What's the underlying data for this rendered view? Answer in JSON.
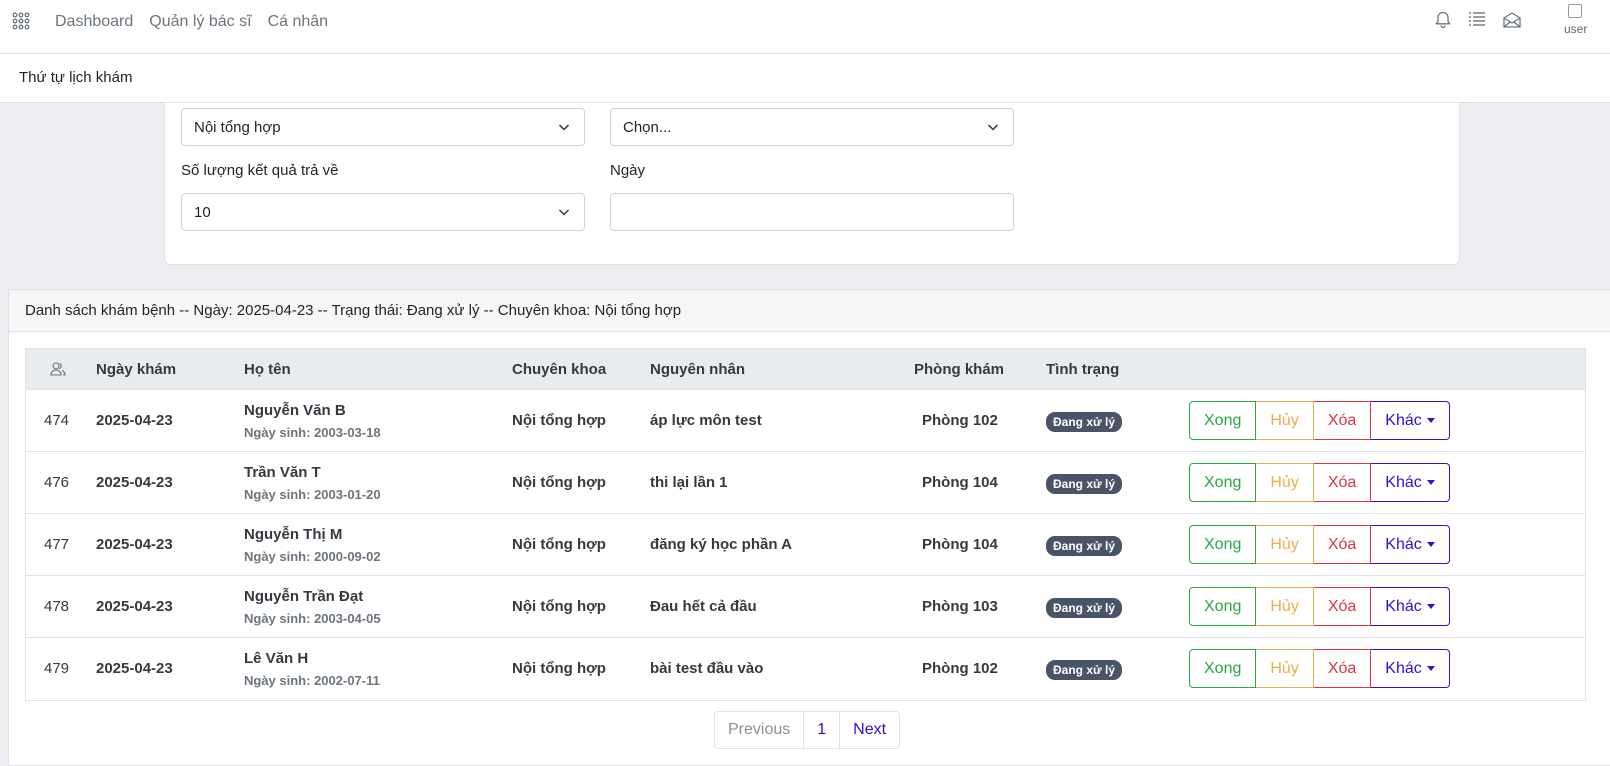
{
  "nav": {
    "links": [
      "Dashboard",
      "Quản lý bác sĩ",
      "Cá nhân"
    ],
    "avatar_alt": "user"
  },
  "subheader": {
    "title": "Thứ tự lịch khám"
  },
  "filters": {
    "specialty_value": "Nội tổng hợp",
    "second_select_value": "Chọn...",
    "limit_label": "Số lượng kết quả trả về",
    "limit_value": "10",
    "date_label": "Ngày",
    "date_value": ""
  },
  "list": {
    "header": "Danh sách khám bệnh -- Ngày: 2025-04-23 -- Trạng thái: Đang xử lý -- Chuyên khoa: Nội tổng hợp",
    "columns": {
      "date": "Ngày khám",
      "name": "Họ tên",
      "specialty": "Chuyên khoa",
      "reason": "Nguyên nhân",
      "room": "Phòng khám",
      "status": "Tình trạng"
    },
    "rows": [
      {
        "id": "474",
        "date": "2025-04-23",
        "name": "Nguyễn Văn B",
        "dob": "Ngày sinh: 2003-03-18",
        "specialty": "Nội tổng hợp",
        "reason": "áp lực môn test",
        "room": "Phòng 102",
        "status": "Đang xử lý"
      },
      {
        "id": "476",
        "date": "2025-04-23",
        "name": "Trần Văn T",
        "dob": "Ngày sinh: 2003-01-20",
        "specialty": "Nội tổng hợp",
        "reason": "thi lại lần 1",
        "room": "Phòng 104",
        "status": "Đang xử lý"
      },
      {
        "id": "477",
        "date": "2025-04-23",
        "name": "Nguyễn Thị M",
        "dob": "Ngày sinh: 2000-09-02",
        "specialty": "Nội tổng hợp",
        "reason": "đăng ký học phần A",
        "room": "Phòng 104",
        "status": "Đang xử lý"
      },
      {
        "id": "478",
        "date": "2025-04-23",
        "name": "Nguyễn Trần Đạt",
        "dob": "Ngày sinh: 2003-04-05",
        "specialty": "Nội tổng hợp",
        "reason": "Đau hết cả đầu",
        "room": "Phòng 103",
        "status": "Đang xử lý"
      },
      {
        "id": "479",
        "date": "2025-04-23",
        "name": "Lê Văn H",
        "dob": "Ngày sinh: 2002-07-11",
        "specialty": "Nội tổng hợp",
        "reason": "bài test đầu vào",
        "room": "Phòng 102",
        "status": "Đang xử lý"
      }
    ],
    "actions": {
      "done": "Xong",
      "cancel": "Hủy",
      "delete": "Xóa",
      "more": "Khác"
    }
  },
  "pagination": {
    "prev": "Previous",
    "page": "1",
    "next": "Next"
  },
  "colors": {
    "done": "#28a745",
    "cancel": "#f0ad4e",
    "delete": "#dc3545",
    "more": "#2f12d1",
    "badge": "#4a5468"
  }
}
